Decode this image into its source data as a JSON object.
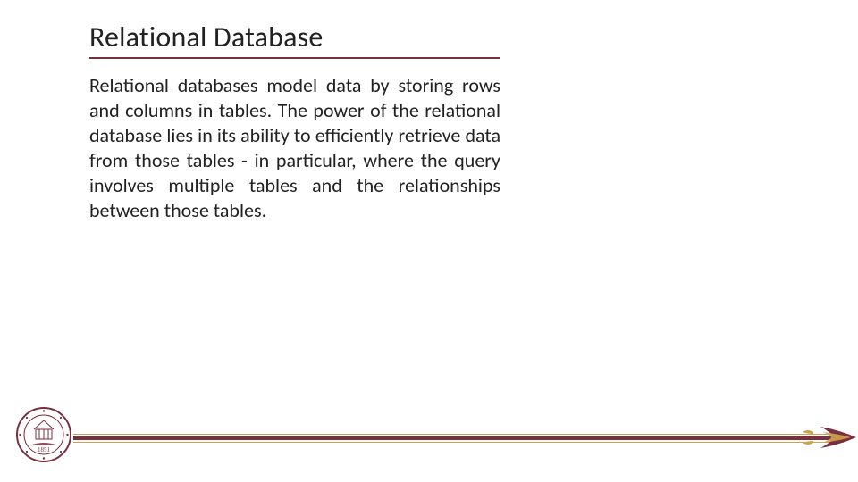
{
  "title": "Relational Database",
  "body": "Relational databases model data by storing rows and columns in tables.  The power of the relational database lies in its ability to efficiently retrieve data from those tables - in particular, where the query involves multiple tables and the relationships between those tables.",
  "seal": {
    "year": "1851"
  },
  "colors": {
    "garnet": "#782f40",
    "gold": "#cda24c"
  }
}
